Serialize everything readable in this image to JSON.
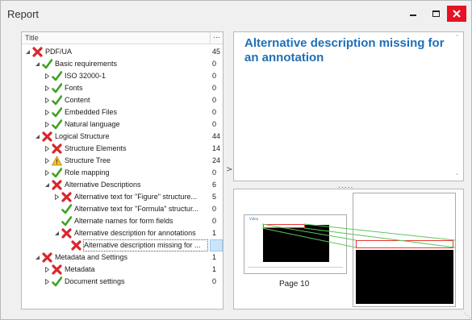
{
  "window": {
    "title": "Report"
  },
  "tree": {
    "header_title": "Title",
    "header_count": "...",
    "rows": [
      {
        "label": "PDF/UA",
        "count": "45",
        "icon": "red-x-icon",
        "depth": 0,
        "expander": "expanded"
      },
      {
        "label": "Basic requirements",
        "count": "0",
        "icon": "green-check-icon",
        "depth": 1,
        "expander": "expanded"
      },
      {
        "label": "ISO 32000-1",
        "count": "0",
        "icon": "green-check-icon",
        "depth": 2,
        "expander": "collapsed"
      },
      {
        "label": "Fonts",
        "count": "0",
        "icon": "green-check-icon",
        "depth": 2,
        "expander": "collapsed"
      },
      {
        "label": "Content",
        "count": "0",
        "icon": "green-check-icon",
        "depth": 2,
        "expander": "collapsed"
      },
      {
        "label": "Embedded Files",
        "count": "0",
        "icon": "green-check-icon",
        "depth": 2,
        "expander": "collapsed"
      },
      {
        "label": "Natural language",
        "count": "0",
        "icon": "green-check-icon",
        "depth": 2,
        "expander": "collapsed"
      },
      {
        "label": "Logical Structure",
        "count": "44",
        "icon": "red-x-icon",
        "depth": 1,
        "expander": "expanded"
      },
      {
        "label": "Structure Elements",
        "count": "14",
        "icon": "red-x-icon",
        "depth": 2,
        "expander": "collapsed"
      },
      {
        "label": "Structure Tree",
        "count": "24",
        "icon": "warning-icon",
        "depth": 2,
        "expander": "collapsed"
      },
      {
        "label": "Role mapping",
        "count": "0",
        "icon": "green-check-icon",
        "depth": 2,
        "expander": "collapsed"
      },
      {
        "label": "Alternative Descriptions",
        "count": "6",
        "icon": "red-x-icon",
        "depth": 2,
        "expander": "expanded"
      },
      {
        "label": "Alternative text for \"Figure\" structure...",
        "count": "5",
        "icon": "red-x-icon",
        "depth": 3,
        "expander": "collapsed"
      },
      {
        "label": "Alternative text for \"Formula\" structur...",
        "count": "0",
        "icon": "green-check-icon",
        "depth": 3,
        "expander": "none"
      },
      {
        "label": "Alternate names for form fields",
        "count": "0",
        "icon": "green-check-icon",
        "depth": 3,
        "expander": "none"
      },
      {
        "label": "Alternative description for annotations",
        "count": "1",
        "icon": "red-x-icon",
        "depth": 3,
        "expander": "expanded"
      },
      {
        "label": "Alternative description missing for ...",
        "count": "",
        "icon": "red-x-icon",
        "depth": 4,
        "expander": "none",
        "selected": true
      },
      {
        "label": "Metadata and Settings",
        "count": "1",
        "icon": "red-x-icon",
        "depth": 1,
        "expander": "expanded"
      },
      {
        "label": "Metadata",
        "count": "1",
        "icon": "red-x-icon",
        "depth": 2,
        "expander": "collapsed"
      },
      {
        "label": "Document settings",
        "count": "0",
        "icon": "green-check-icon",
        "depth": 2,
        "expander": "collapsed"
      }
    ]
  },
  "details": {
    "heading": "Alternative description missing for an annotation"
  },
  "preview": {
    "page_label": "Page 10",
    "thumb_header": "Video"
  },
  "colors": {
    "heading_blue": "#1f6fb8",
    "error_red": "#d9262d",
    "ok_green": "#3ca31f",
    "warning_yellow": "#f2c12e",
    "close_red": "#e81123"
  }
}
